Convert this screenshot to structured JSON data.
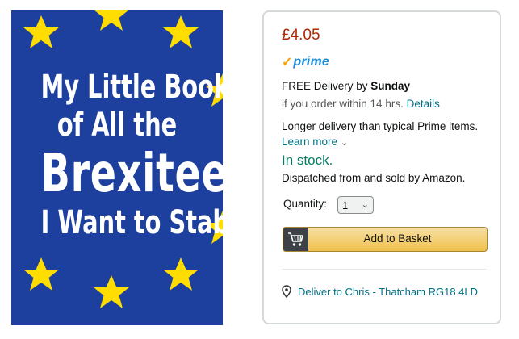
{
  "cover": {
    "line1": "My Little Book",
    "line2": "of All the",
    "line3": "Brexiteers",
    "line4": "I Want to Stab",
    "background": "#1d3f9e",
    "star_color": "#ffdd00"
  },
  "buybox": {
    "price": "£4.05",
    "prime_check": "✓",
    "prime_word": "prime",
    "free_delivery_prefix": "FREE Delivery by ",
    "free_delivery_day": "Sunday",
    "order_within": "if you order within 14 hrs. ",
    "details_link": "Details",
    "longer_delivery": "Longer delivery than typical Prime items. ",
    "learn_more_link": "Learn more",
    "learn_more_chevron": "⌄",
    "stock_status": "In stock.",
    "dispatch": "Dispatched from and sold by Amazon.",
    "quantity_label": "Quantity:",
    "quantity_value": "1",
    "quantity_chevron": "⌄",
    "add_to_basket": "Add to Basket",
    "deliver_to": "Deliver to Chris - Thatcham RG18 4LD",
    "colors": {
      "price": "#b12704",
      "stock": "#067d62",
      "link": "#007185",
      "button": "#f0c14b"
    }
  }
}
